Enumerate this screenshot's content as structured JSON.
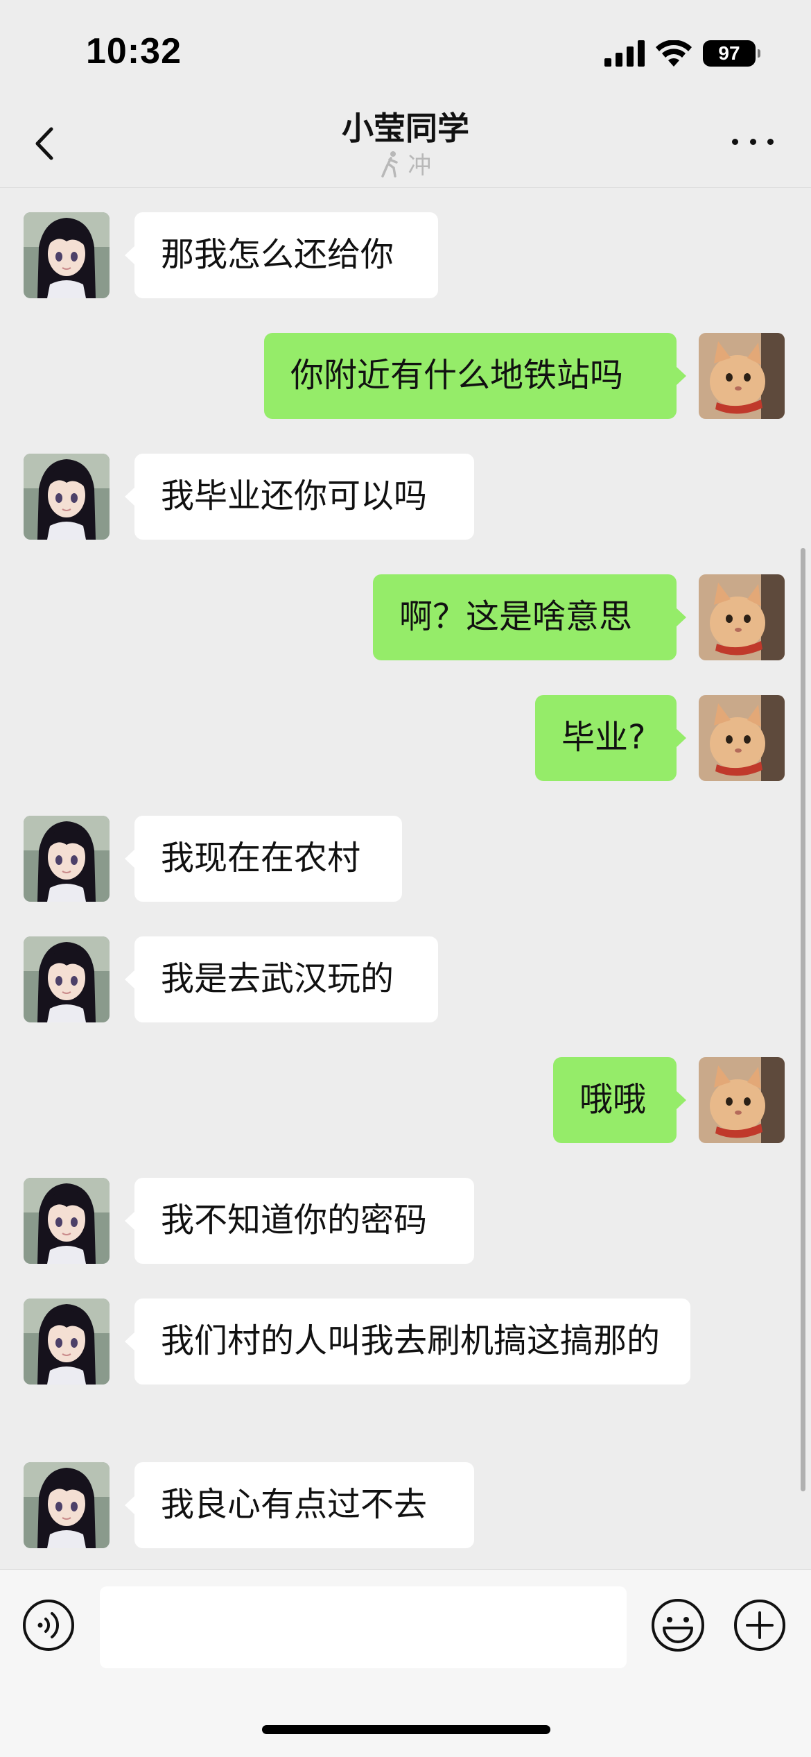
{
  "status_bar": {
    "time": "10:32",
    "battery": "97",
    "icons": [
      "signal-icon",
      "wifi-icon",
      "battery-icon"
    ]
  },
  "nav": {
    "title": "小莹同学",
    "status_text": "冲",
    "status_icon": "running-person-icon",
    "back_icon": "chevron-left-icon",
    "more_icon": "more-dots-icon"
  },
  "colors": {
    "background": "#ededed",
    "sent_bubble": "#95ec69",
    "received_bubble": "#ffffff",
    "input_bar": "#f6f6f6"
  },
  "messages": [
    {
      "side": "left",
      "text": "那我怎么还给你"
    },
    {
      "side": "right",
      "text": "你附近有什么地铁站吗"
    },
    {
      "side": "left",
      "text": "我毕业还你可以吗"
    },
    {
      "side": "right",
      "text": "啊？这是啥意思"
    },
    {
      "side": "right",
      "text": "毕业?"
    },
    {
      "side": "left",
      "text": "我现在在农村"
    },
    {
      "side": "left",
      "text": "我是去武汉玩的"
    },
    {
      "side": "right",
      "text": "哦哦"
    },
    {
      "side": "left",
      "text": "我不知道你的密码"
    },
    {
      "side": "left",
      "text": "我们村的人叫我去刷机搞这搞那的"
    },
    {
      "side": "left",
      "text": "我良心有点过不去"
    }
  ],
  "input_bar": {
    "value": "",
    "voice_icon": "voice-icon",
    "emoji_icon": "emoji-icon",
    "plus_icon": "plus-icon"
  }
}
